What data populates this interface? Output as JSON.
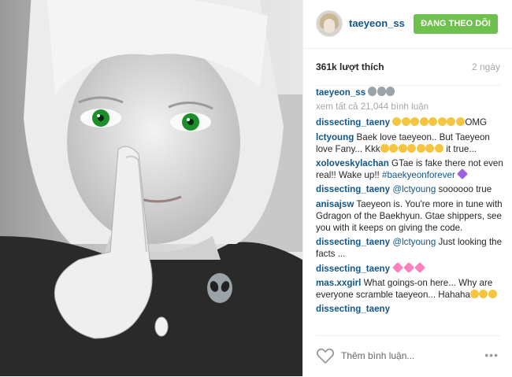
{
  "header": {
    "username": "taeyeon_ss",
    "follow_label": "ĐANG THEO DÕI"
  },
  "stats": {
    "likes": "361k lượt thích",
    "time": "2 ngày"
  },
  "caption": {
    "username": "taeyeon_ss"
  },
  "view_all": "xem tất cả 21,044 bình luận",
  "comments": [
    {
      "user": "dissecting_taeny",
      "text": "OMG"
    },
    {
      "user": "lctyoung",
      "text": "Baek love taeyeon.. But Taeyeon love Fany... Kkk",
      "text2": "it true..."
    },
    {
      "user": "xoloveskylachan",
      "text": "GTae is fake there not even real!! Wake up!!",
      "tag": "#baekyeonforever"
    },
    {
      "user": "dissecting_taeny",
      "mention": "@lctyoung",
      "text": "soooooo true"
    },
    {
      "user": "anisajsw",
      "text": "Taeyeon is. You're more in tune with Gdragon of the Baekhyun. Gtae shippers, see you with it keeps on giving the code."
    },
    {
      "user": "dissecting_taeny",
      "mention": "@lctyoung",
      "text": "Just looking the facts ..."
    },
    {
      "user": "dissecting_taeny"
    },
    {
      "user": "mas.xxgirl",
      "text": "What goings-on here... Why are everyone scramble taeyeon... Hahaha"
    },
    {
      "user": "dissecting_taeny"
    }
  ],
  "footer": {
    "placeholder": "Thêm bình luận...",
    "more": "•••"
  },
  "icons": {
    "like": "heart-outline-icon",
    "more": "more-dots-icon",
    "emoji": "emoji-icon"
  }
}
